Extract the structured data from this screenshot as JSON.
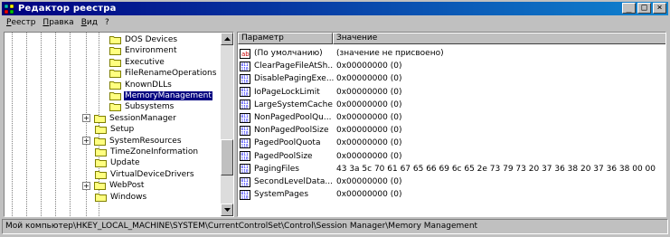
{
  "window": {
    "title": "Редактор реестра"
  },
  "menu": [
    {
      "label": "Реестр",
      "u": "Р",
      "rest": "еестр"
    },
    {
      "label": "Правка",
      "u": "П",
      "rest": "равка"
    },
    {
      "label": "Вид",
      "u": "В",
      "rest": "ид"
    },
    {
      "label": "?",
      "u": "",
      "rest": "?"
    }
  ],
  "tree": {
    "items": [
      {
        "label": "DOS Devices"
      },
      {
        "label": "Environment"
      },
      {
        "label": "Executive"
      },
      {
        "label": "FileRenameOperations"
      },
      {
        "label": "KnownDLLs"
      },
      {
        "label": "MemoryManagement",
        "selected": true
      },
      {
        "label": "Subsystems"
      },
      {
        "label": "SessionManager",
        "expander": "+"
      },
      {
        "label": "Setup"
      },
      {
        "label": "SystemResources",
        "expander": "+"
      },
      {
        "label": "TimeZoneInformation"
      },
      {
        "label": "Update"
      },
      {
        "label": "VirtualDeviceDrivers"
      },
      {
        "label": "WebPost",
        "expander": "+"
      },
      {
        "label": "Windows"
      }
    ]
  },
  "list": {
    "columns": {
      "name": "Параметр",
      "value": "Значение"
    },
    "rows": [
      {
        "icon": "string-value-icon",
        "name": "(По умолчанию)",
        "value": "(значение не присвоено)"
      },
      {
        "icon": "binary-value-icon",
        "name": "ClearPageFileAtSh...",
        "value": "0x00000000 (0)"
      },
      {
        "icon": "binary-value-icon",
        "name": "DisablePagingExe...",
        "value": "0x00000000 (0)"
      },
      {
        "icon": "binary-value-icon",
        "name": "IoPageLockLimit",
        "value": "0x00000000 (0)"
      },
      {
        "icon": "binary-value-icon",
        "name": "LargeSystemCache",
        "value": "0x00000000 (0)"
      },
      {
        "icon": "binary-value-icon",
        "name": "NonPagedPoolQu...",
        "value": "0x00000000 (0)"
      },
      {
        "icon": "binary-value-icon",
        "name": "NonPagedPoolSize",
        "value": "0x00000000 (0)"
      },
      {
        "icon": "binary-value-icon",
        "name": "PagedPoolQuota",
        "value": "0x00000000 (0)"
      },
      {
        "icon": "binary-value-icon",
        "name": "PagedPoolSize",
        "value": "0x00000000 (0)"
      },
      {
        "icon": "binary-value-icon",
        "name": "PagingFiles",
        "value": "43 3a 5c 70 61 67 65 66 69 6c 65 2e 73 79 73 20 37 36 38 20 37 36 38 00 00"
      },
      {
        "icon": "binary-value-icon",
        "name": "SecondLevelData...",
        "value": "0x00000000 (0)"
      },
      {
        "icon": "binary-value-icon",
        "name": "SystemPages",
        "value": "0x00000000 (0)"
      }
    ]
  },
  "status": {
    "path": "Мой компьютер\\HKEY_LOCAL_MACHINE\\SYSTEM\\CurrentControlSet\\Control\\Session Manager\\Memory Management"
  },
  "colors": {
    "titlebar": "#000080",
    "selection": "#000080",
    "face": "#c0c0c0"
  }
}
